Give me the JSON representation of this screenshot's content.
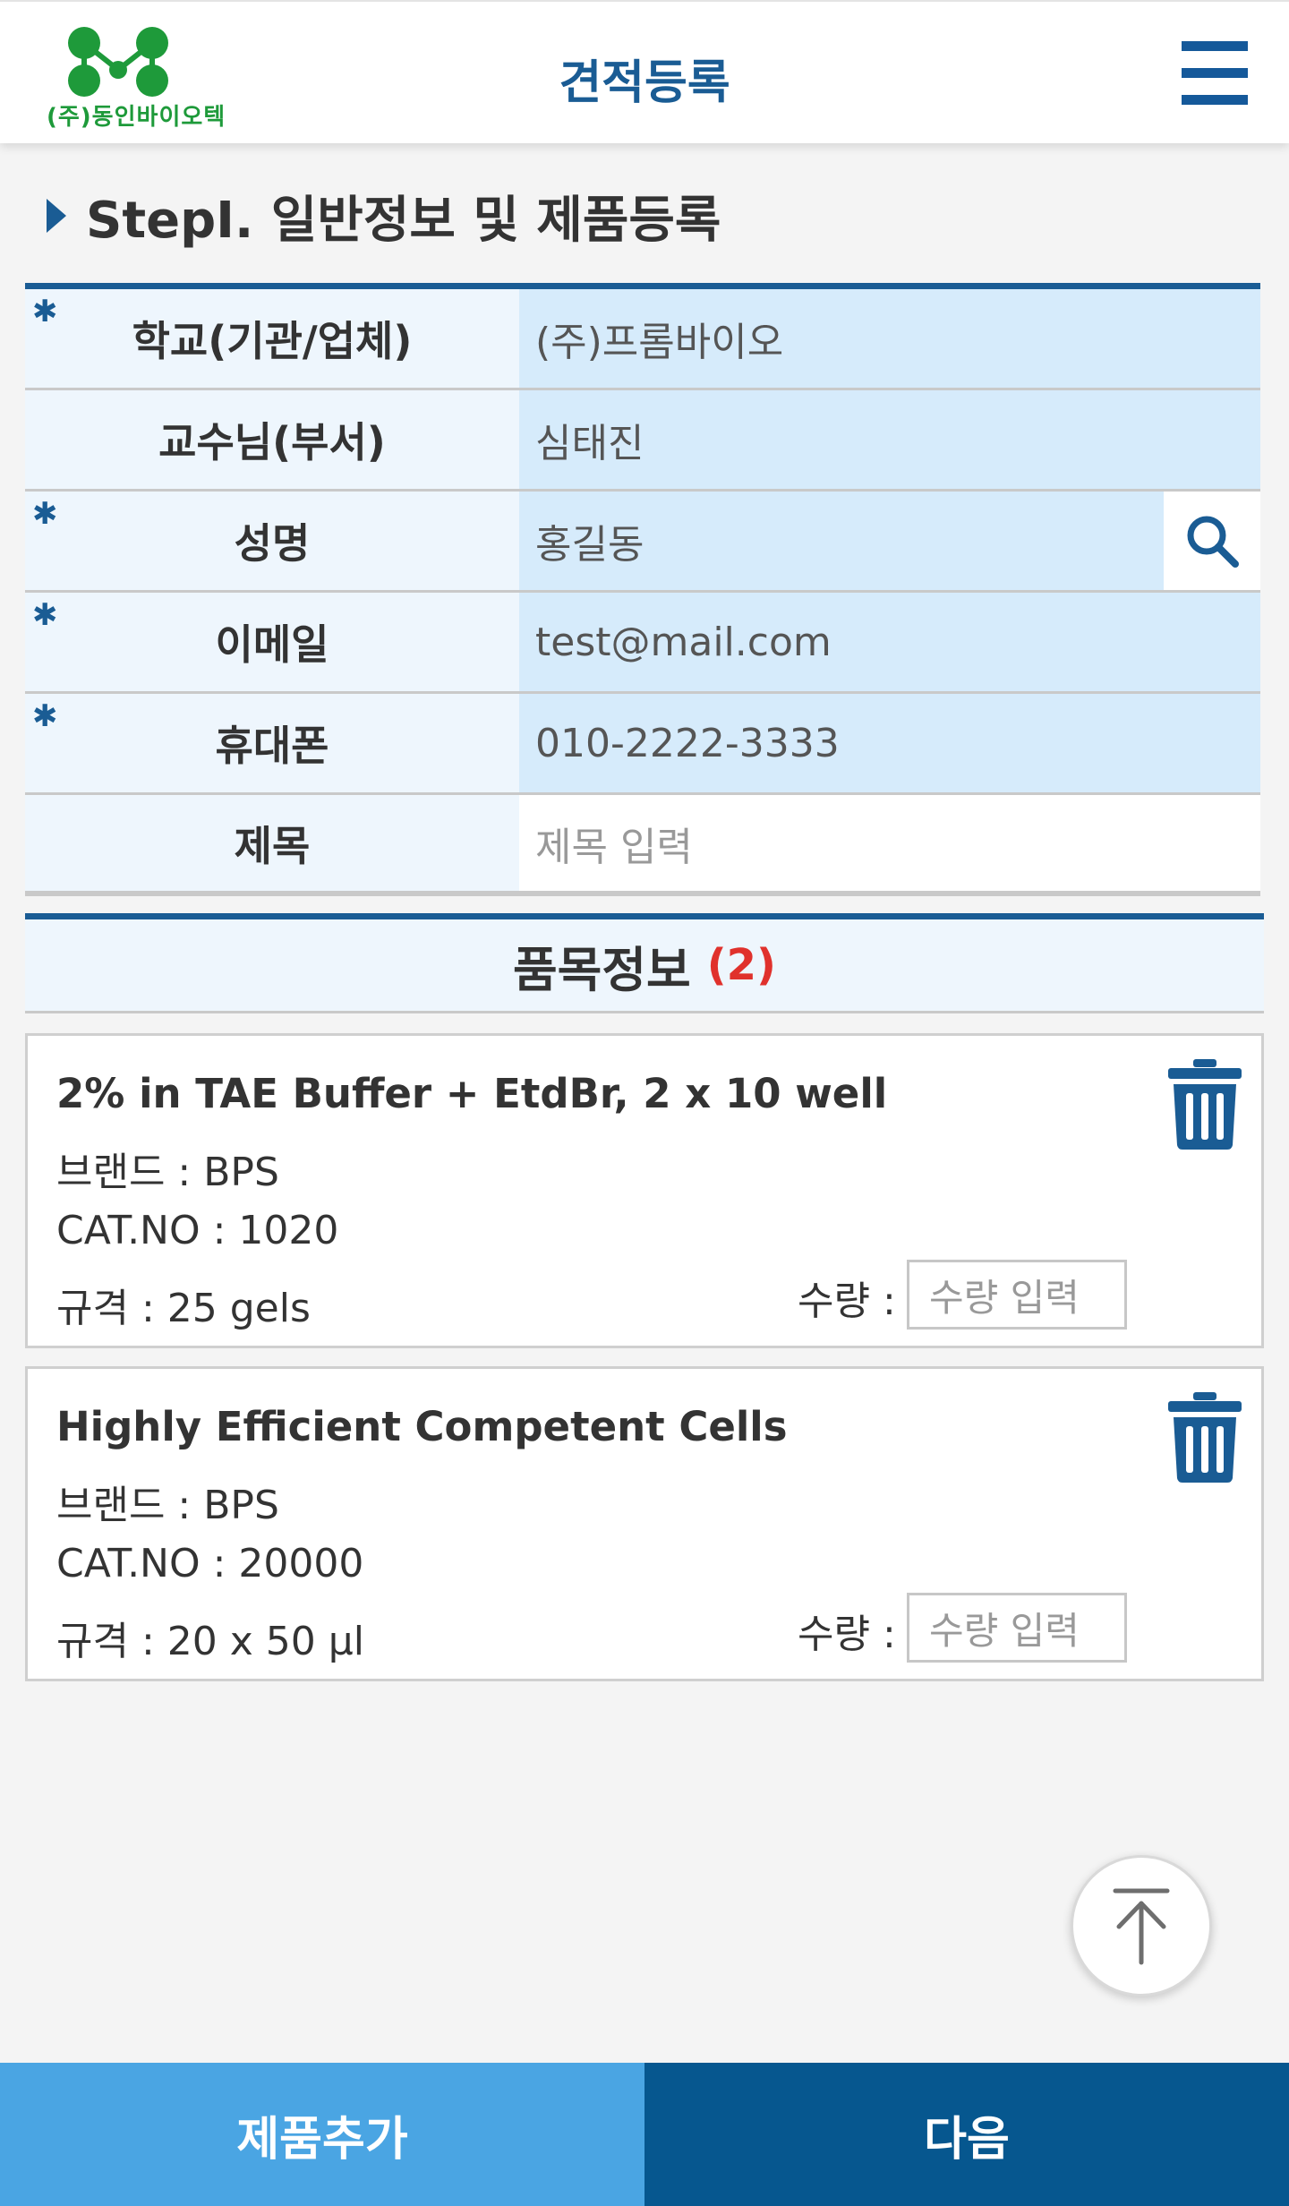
{
  "header": {
    "logo_text": "(주)동인바이오텍",
    "title": "견적등록"
  },
  "step": {
    "title": "StepI. 일반정보 및 제품등록"
  },
  "form": {
    "school": {
      "label": "학교(기관/업체)",
      "value": "(주)프롬바이오",
      "required": true
    },
    "professor": {
      "label": "교수님(부서)",
      "value": "심태진",
      "required": false
    },
    "name": {
      "label": "성명",
      "value": "홍길동",
      "required": true
    },
    "email": {
      "label": "이메일",
      "value": "test@mail.com",
      "required": true
    },
    "phone": {
      "label": "휴대폰",
      "value": "010-2222-3333",
      "required": true
    },
    "subject": {
      "label": "제목",
      "placeholder": "제목 입력",
      "required": false
    }
  },
  "items": {
    "title": "품목정보",
    "count": "(2)",
    "list": [
      {
        "name": "2% in TAE Buffer + EtdBr, 2 x 10 well",
        "brand": "브랜드 : BPS",
        "cat": "CAT.NO : 1020",
        "spec": "규격 : 25 gels",
        "qty_label": "수량 :",
        "qty_placeholder": "수량 입력"
      },
      {
        "name": "Highly Efficient Competent Cells",
        "brand": "브랜드 : BPS",
        "cat": "CAT.NO : 20000",
        "spec": "규격 : 20 x 50 μl",
        "qty_label": "수량 :",
        "qty_placeholder": "수량 입력"
      }
    ]
  },
  "buttons": {
    "add_product": "제품추가",
    "next": "다음"
  },
  "colors": {
    "primary": "#1a5c94",
    "accent_light": "#4aa5e3",
    "accent_dark": "#06578f",
    "field_bg": "#d6ebfb",
    "label_bg": "#eef6fd",
    "count_red": "#e0312c",
    "logo_green": "#1e9a3a"
  },
  "icons": {
    "menu": "hamburger-menu-icon",
    "search": "search-icon",
    "trash": "trash-icon",
    "scroll_top": "arrow-up-icon",
    "required": "asterisk-icon"
  }
}
